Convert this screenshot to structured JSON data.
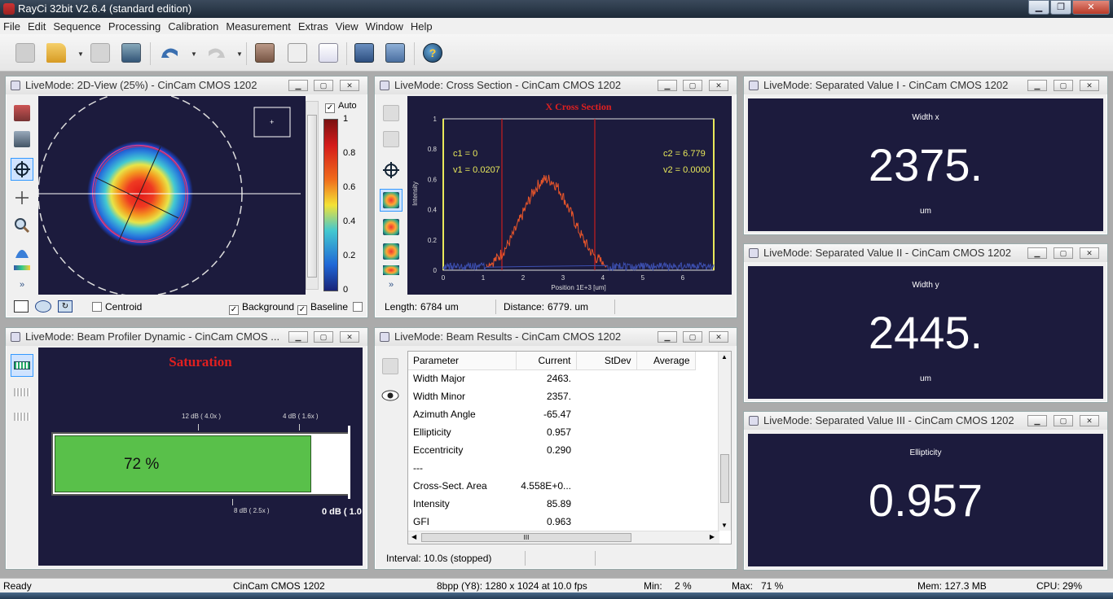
{
  "app": {
    "title": "RayCi 32bit V2.6.4 (standard edition)"
  },
  "menu": [
    "File",
    "Edit",
    "Sequence",
    "Processing",
    "Calibration",
    "Measurement",
    "Extras",
    "View",
    "Window",
    "Help"
  ],
  "windows": {
    "view2d": {
      "title": "LiveMode: 2D-View (25%) - CinCam CMOS 1202",
      "auto_label": "Auto",
      "colorbar_ticks": [
        "1",
        "0.8",
        "0.6",
        "0.4",
        "0.2",
        "0"
      ],
      "centroid_label": "Centroid",
      "background_label": "Background",
      "baseline_label": "Baseline",
      "more_label": "»"
    },
    "cross": {
      "title": "LiveMode: Cross Section - CinCam CMOS 1202",
      "plot_title": "X Cross Section",
      "ylabel": "Intensity",
      "xlabel": "Position 1E+3 [um]",
      "c1": "c1 = 0",
      "v1": "v1 = 0.0207",
      "c2": "c2 = 6.779",
      "v2": "v2 = 0.0000",
      "yticks": [
        "1",
        "0.8",
        "0.6",
        "0.4",
        "0.2",
        "0"
      ],
      "xticks": [
        "0",
        "1",
        "2",
        "3",
        "4",
        "5",
        "6"
      ],
      "length_label": "Length:",
      "length_value": "6784 um",
      "distance_label": "Distance:",
      "distance_value": "6779. um",
      "more_label": "»"
    },
    "sep1": {
      "title": "LiveMode: Separated Value I - CinCam CMOS 1202",
      "caption": "Width x",
      "value": "2375.",
      "unit": "um"
    },
    "sep2": {
      "title": "LiveMode: Separated Value II - CinCam CMOS 1202",
      "caption": "Width y",
      "value": "2445.",
      "unit": "um"
    },
    "sep3": {
      "title": "LiveMode: Separated Value III - CinCam CMOS 1202",
      "caption": "Ellipticity",
      "value": "0.957"
    },
    "profiler": {
      "title": "LiveMode: Beam Profiler Dynamic - CinCam CMOS ...",
      "saturation": "Saturation",
      "percent": "72 %",
      "fill_fraction": 0.88,
      "tick_top_1": "12 dB ( 4.0x )",
      "tick_top_2": "4 dB ( 1.6x )",
      "tick_bottom_1": "8 dB ( 2.5x )",
      "tick_bottom_2": "0 dB ( 1.0"
    },
    "results": {
      "title": "LiveMode: Beam Results - CinCam CMOS 1202",
      "columns": [
        "Parameter",
        "Current",
        "StDev",
        "Average"
      ],
      "rows": [
        {
          "p": "Width Major",
          "c": "2463."
        },
        {
          "p": "Width Minor",
          "c": "2357."
        },
        {
          "p": "Azimuth Angle",
          "c": "-65.47"
        },
        {
          "p": "Ellipticity",
          "c": "0.957"
        },
        {
          "p": "Eccentricity",
          "c": "0.290"
        },
        {
          "p": "---",
          "c": ""
        },
        {
          "p": "Cross-Sect. Area",
          "c": "4.558E+0..."
        },
        {
          "p": "Intensity",
          "c": "85.89"
        },
        {
          "p": "GFI",
          "c": "0.963"
        }
      ],
      "hscroll_grip": "III",
      "interval": "Interval:  10.0s (stopped)"
    }
  },
  "status": {
    "ready": "Ready",
    "camera": "CinCam CMOS 1202",
    "format": "8bpp (Y8): 1280 x 1024 at 10.0 fps",
    "min_label": "Min:",
    "min_value": "2 %",
    "max_label": "Max:",
    "max_value": "71 %",
    "mem": "Mem: 127.3 MB",
    "cpu": "CPU: 29%"
  },
  "colors": {
    "panel_dark": "#1c1b3d",
    "bar_green": "#59c04a",
    "saturation_red": "#e02020",
    "cross_yellow": "#e8e85a"
  }
}
